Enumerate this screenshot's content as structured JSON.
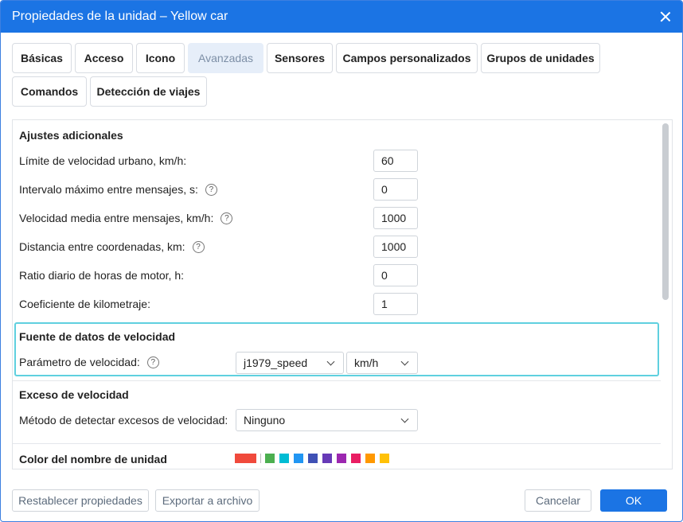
{
  "window": {
    "title": "Propiedades de la unidad – Yellow car"
  },
  "tabs": [
    {
      "label": "Básicas"
    },
    {
      "label": "Acceso"
    },
    {
      "label": "Icono"
    },
    {
      "label": "Avanzadas"
    },
    {
      "label": "Sensores"
    },
    {
      "label": "Campos personalizados"
    },
    {
      "label": "Grupos de unidades"
    },
    {
      "label": "Comandos"
    },
    {
      "label": "Detección de viajes"
    }
  ],
  "active_tab": "Avanzadas",
  "additional": {
    "title": "Ajustes adicionales",
    "rows": [
      {
        "label": "Límite de velocidad urbano, km/h:",
        "value": "60"
      },
      {
        "label": "Intervalo máximo entre mensajes, s:",
        "value": "0"
      },
      {
        "label": "Velocidad media entre mensajes, km/h:",
        "value": "1000"
      },
      {
        "label": "Distancia entre coordenadas, km:",
        "value": "1000"
      },
      {
        "label": "Ratio diario de horas de motor, h:",
        "value": "0"
      },
      {
        "label": "Coeficiente de kilometraje:",
        "value": "1"
      }
    ]
  },
  "speed_source": {
    "title": "Fuente de datos de velocidad",
    "param_label": "Parámetro de velocidad:",
    "param_value": "j1979_speed",
    "unit_value": "km/h"
  },
  "overspeed": {
    "title": "Exceso de velocidad",
    "method_label": "Método de detectar excesos de velocidad:",
    "method_value": "Ninguno"
  },
  "unit_color": {
    "title": "Color del nombre de unidad",
    "selected": "#f04a3c",
    "palette": [
      "#4caf50",
      "#00bcd4",
      "#2196f3",
      "#3f51b5",
      "#673ab7",
      "#9c27b0",
      "#e91e63",
      "#ff9800",
      "#ffc107"
    ]
  },
  "help_glyph": "?",
  "footer": {
    "reset_label": "Restablecer propiedades",
    "export_label": "Exportar a archivo",
    "cancel_label": "Cancelar",
    "ok_label": "OK"
  }
}
